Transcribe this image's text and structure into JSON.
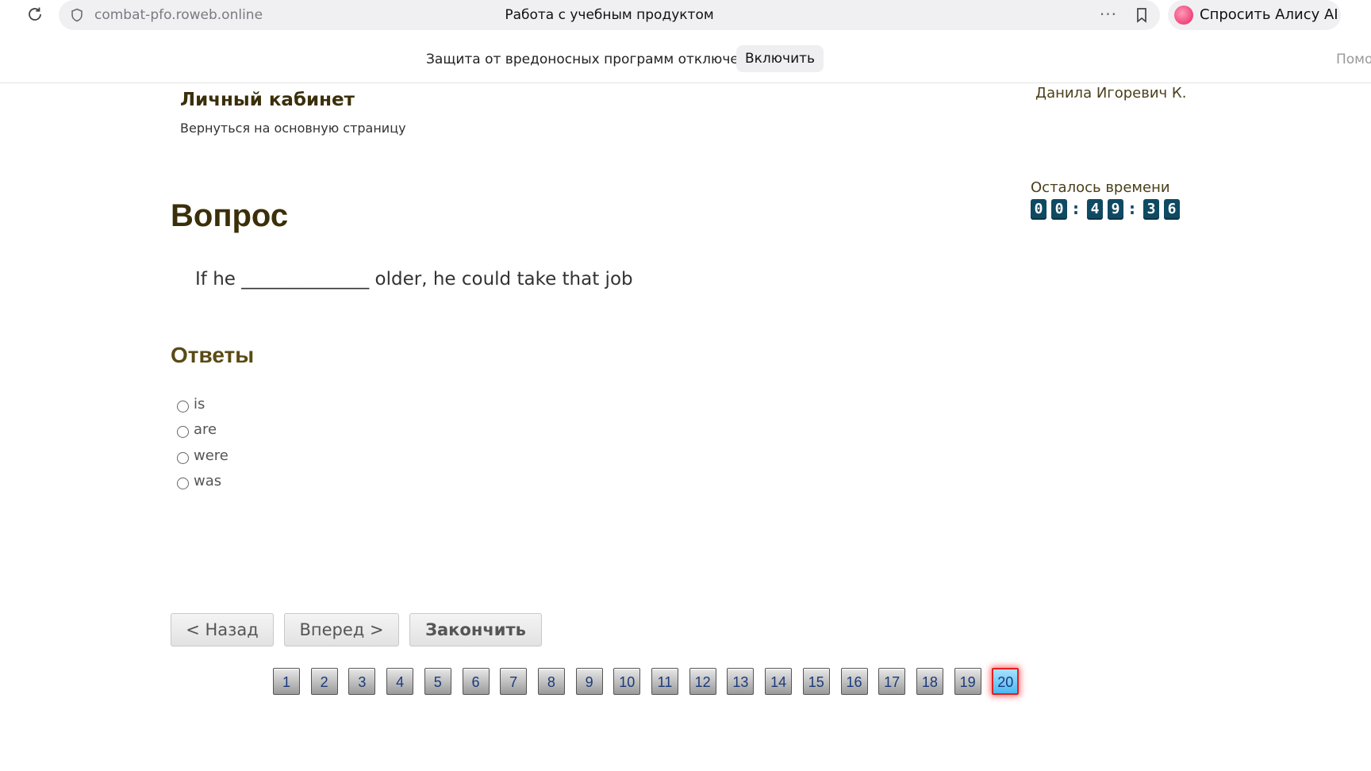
{
  "browser": {
    "url": "combat-pfo.roweb.online",
    "tab_title": "Работа с учебным продуктом",
    "alice_label": "Спросить Алису AI"
  },
  "security_bar": {
    "message": "Защита от вредоносных программ отключена",
    "enable_label": "Включить",
    "help_label": "Помо"
  },
  "header": {
    "cabinet_title": "Личный кабинет",
    "back_link": "Вернуться на основную страницу",
    "user_name": "Данила Игоревич К."
  },
  "timer": {
    "label": "Осталось времени",
    "digits": [
      "0",
      "0",
      "4",
      "9",
      "3",
      "6"
    ],
    "separator": ":"
  },
  "question": {
    "heading": "Вопрос",
    "text": "If he ______________ older, he could take that job"
  },
  "answers": {
    "heading": "Ответы",
    "options": [
      "is",
      "are",
      "were",
      "was"
    ]
  },
  "navigation": {
    "back_label": "< Назад",
    "next_label": "Вперед >",
    "finish_label": "Закончить"
  },
  "pager": {
    "pages": [
      "1",
      "2",
      "3",
      "4",
      "5",
      "6",
      "7",
      "8",
      "9",
      "10",
      "11",
      "12",
      "13",
      "14",
      "15",
      "16",
      "17",
      "18",
      "19",
      "20"
    ],
    "current": "20"
  }
}
